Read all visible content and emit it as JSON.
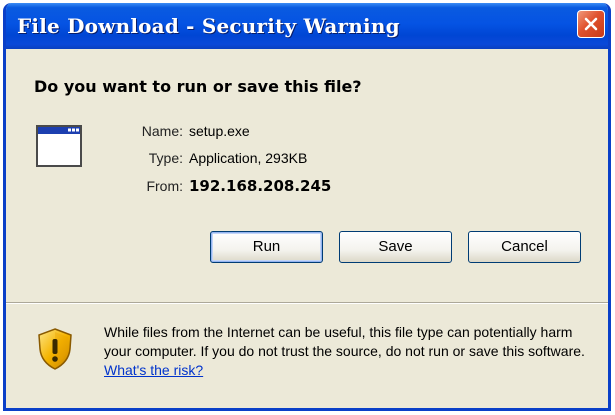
{
  "window": {
    "title": "File Download - Security Warning"
  },
  "dialog": {
    "question": "Do you want to run or save this file?",
    "file": {
      "name_label": "Name:",
      "name_value": "setup.exe",
      "type_label": "Type:",
      "type_value": "Application, 293KB",
      "from_label": "From:",
      "from_value": "192.168.208.245",
      "icon": "application-window-icon"
    },
    "buttons": {
      "run": "Run",
      "save": "Save",
      "cancel": "Cancel"
    },
    "warning": {
      "icon": "shield-warning-icon",
      "text": "While files from the Internet can be useful, this file type can potentially harm your computer. If you do not trust the source, do not run or save this software. ",
      "link": "What's the risk?"
    }
  },
  "colors": {
    "titlebar": "#0553e3",
    "close_button": "#e0522e",
    "dialog_background": "#ece9d8",
    "link": "#0033cc"
  }
}
